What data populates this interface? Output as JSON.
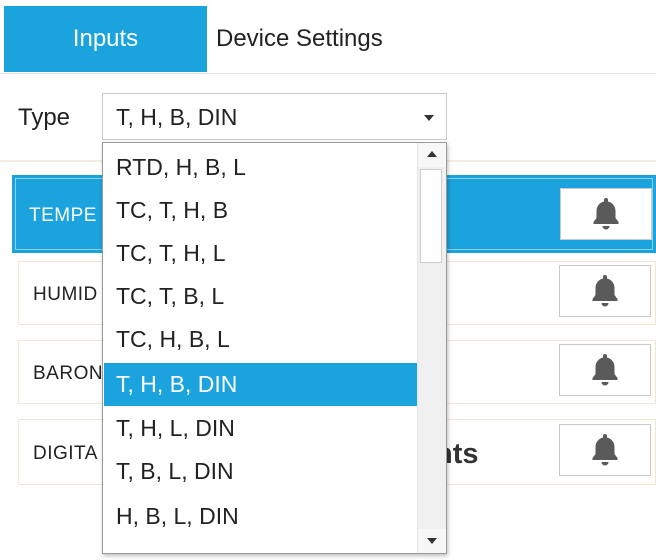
{
  "tabs": [
    {
      "label": "Inputs",
      "active": true
    },
    {
      "label": "Device Settings",
      "active": false
    }
  ],
  "type_selector": {
    "label": "Type",
    "value": "T, H, B, DIN",
    "options": [
      "RTD, H, B, L",
      "TC, T, H, B",
      "TC, T, H, L",
      "TC, T, B, L",
      "TC, H, B, L",
      "T, H, B, DIN",
      "T, H, L, DIN",
      "T, B, L, DIN",
      "H, B, L, DIN"
    ],
    "selected_index": 5
  },
  "inputs": [
    {
      "label": "TEMPE",
      "active": true
    },
    {
      "label": "HUMID",
      "active": false
    },
    {
      "label": "BARON",
      "active": false
    },
    {
      "label": "DIGITA",
      "active": false,
      "trailing_text": "hts"
    }
  ],
  "icons": {
    "alarm": "bell-icon",
    "dropdown": "chevron-down-icon",
    "scroll_up": "chevron-up-icon",
    "scroll_down": "chevron-down-icon"
  },
  "colors": {
    "accent": "#1aa3dd",
    "icon": "#5a5a5a"
  }
}
